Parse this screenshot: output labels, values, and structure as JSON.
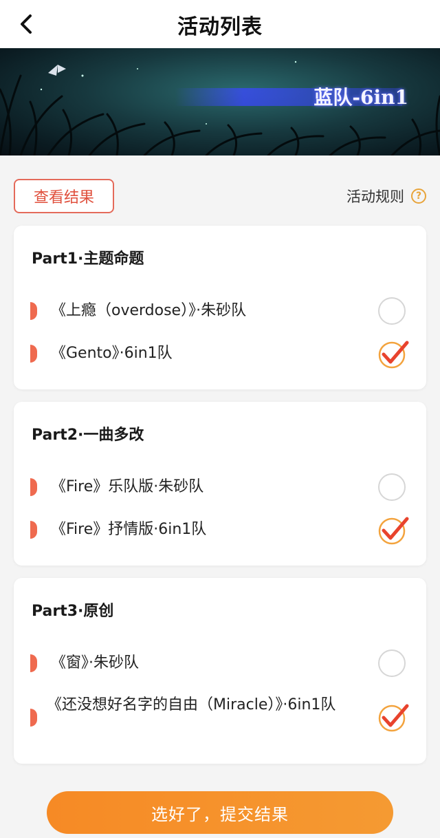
{
  "header": {
    "title": "活动列表",
    "back_icon": "chevron-left-icon"
  },
  "banner": {
    "caption": "蓝队-6in1"
  },
  "toolbar": {
    "view_result_label": "查看结果",
    "rules_label": "活动规则",
    "rules_icon": "help-circle-icon"
  },
  "sections": [
    {
      "title": "Part1·主题命题",
      "options": [
        {
          "label": "《上瘾（overdose）》·朱砂队",
          "selected": false
        },
        {
          "label": "《Gento》·6in1队",
          "selected": true
        }
      ]
    },
    {
      "title": "Part2·一曲多改",
      "options": [
        {
          "label": "《Fire》乐队版·朱砂队",
          "selected": false
        },
        {
          "label": "《Fire》抒情版·6in1队",
          "selected": true
        }
      ]
    },
    {
      "title": "Part3·原创",
      "options": [
        {
          "label": "《窗》·朱砂队",
          "selected": false
        },
        {
          "label": "《还没想好名字的自由（Miracle）》·6in1队",
          "selected": true
        }
      ]
    }
  ],
  "submit": {
    "label": "选好了，提交结果"
  },
  "colors": {
    "accent": "#f68a25",
    "marker": "#ef6a4f",
    "view_result": "#e0503d"
  }
}
